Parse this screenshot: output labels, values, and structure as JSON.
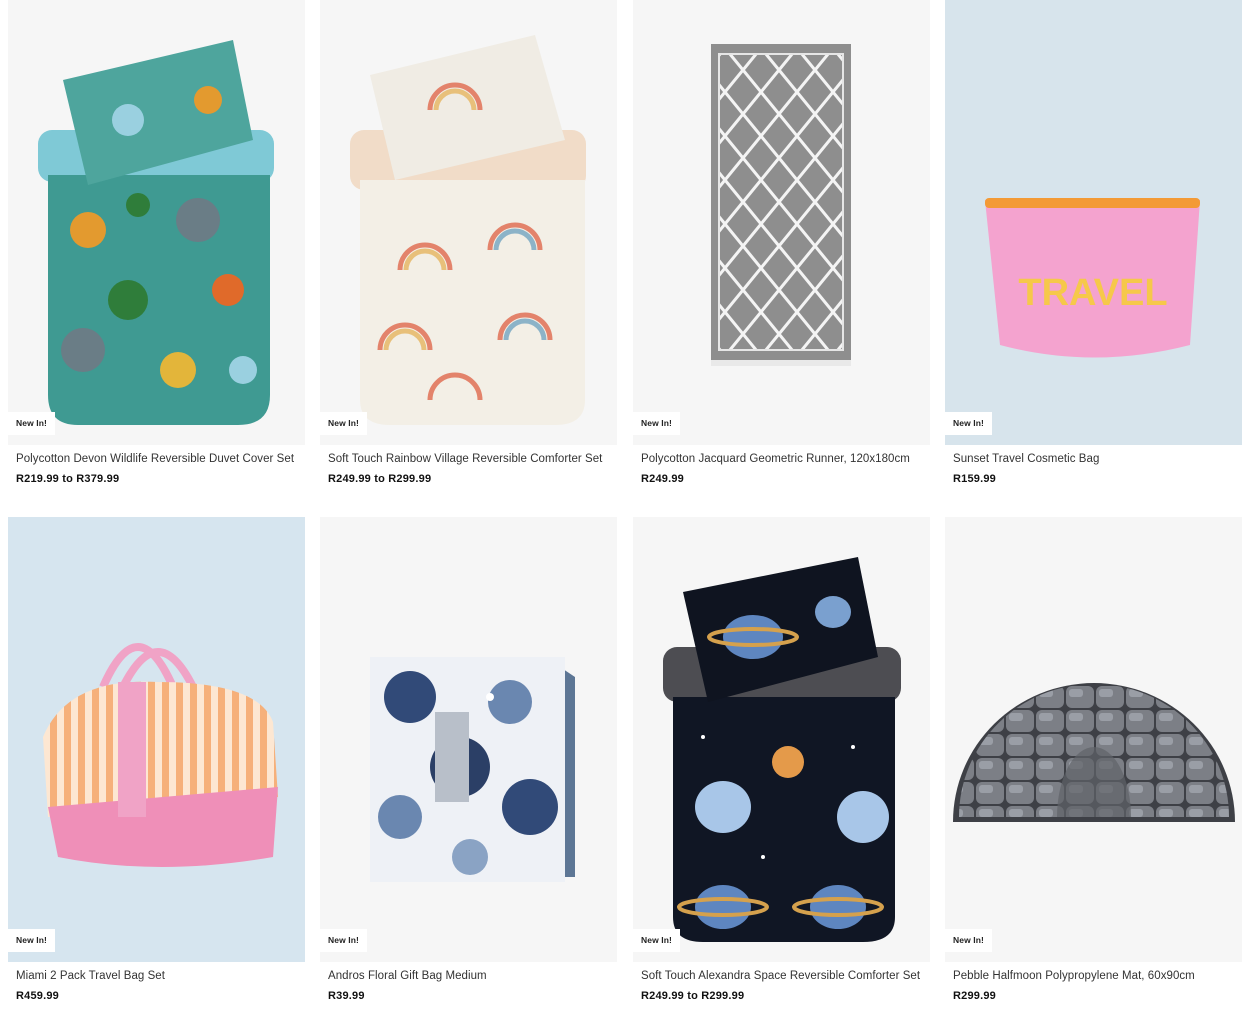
{
  "products": [
    {
      "title": "Polycotton Devon Wildlife Reversible Duvet Cover Set",
      "price": "R219.99 to R379.99",
      "badge": "New In!",
      "image_icon": "jungle-print-duvet-image"
    },
    {
      "title": "Soft Touch Rainbow Village Reversible Comforter Set",
      "price": "R249.99 to R299.99",
      "badge": "New In!",
      "image_icon": "rainbow-print-comforter-image"
    },
    {
      "title": "Polycotton Jacquard Geometric Runner, 120x180cm",
      "price": "R249.99",
      "badge": "New In!",
      "image_icon": "geometric-runner-image"
    },
    {
      "title": "Sunset Travel Cosmetic Bag",
      "price": "R159.99",
      "badge": "New In!",
      "image_icon": "pink-cosmetic-bag-image",
      "print_text": "TRAVEL"
    },
    {
      "title": "Miami 2 Pack Travel Bag Set",
      "price": "R459.99",
      "badge": "New In!",
      "image_icon": "striped-travel-bag-image"
    },
    {
      "title": "Andros Floral Gift Bag Medium",
      "price": "R39.99",
      "badge": "New In!",
      "image_icon": "floral-gift-bag-image"
    },
    {
      "title": "Soft Touch Alexandra Space Reversible Comforter Set",
      "price": "R249.99 to R299.99",
      "badge": "New In!",
      "image_icon": "space-print-comforter-image"
    },
    {
      "title": "Pebble Halfmoon Polypropylene Mat, 60x90cm",
      "price": "R299.99",
      "badge": "New In!",
      "image_icon": "pebble-halfmoon-mat-image"
    }
  ]
}
